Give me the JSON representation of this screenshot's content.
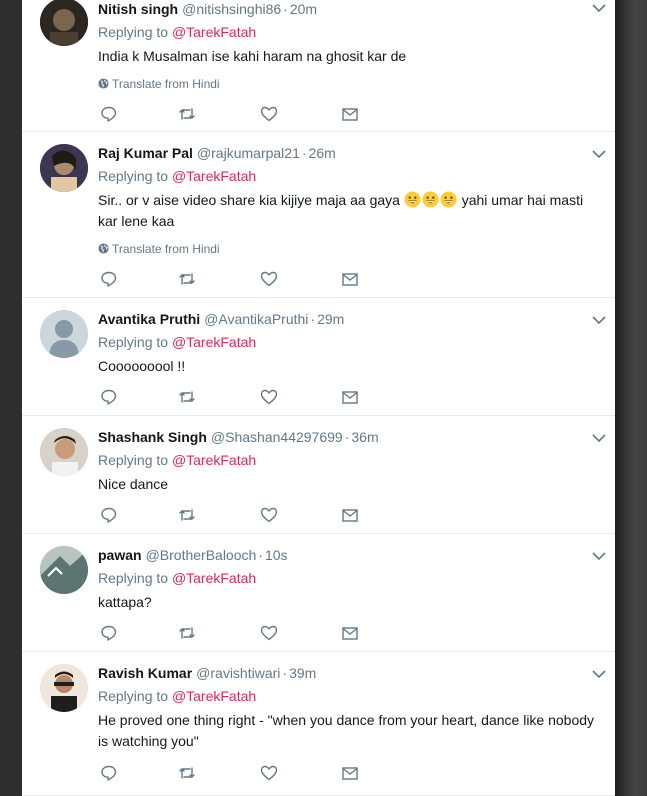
{
  "replies": [
    {
      "name": "Nitish singh",
      "handle": "@nitishsinghi86",
      "time": "20m",
      "replying_prefix": "Replying to",
      "mention": "@TarekFatah",
      "text": "India k Musalman ise kahi haram na ghosit kar de",
      "translate": "Translate from Hindi",
      "avatar_color": "#4a4036"
    },
    {
      "name": "Raj Kumar Pal",
      "handle": "@rajkumarpal21",
      "time": "26m",
      "replying_prefix": "Replying to",
      "mention": "@TarekFatah",
      "text_before_emoji": "Sir.. or v aise video share kia kijiye maja aa gaya",
      "text_after_emoji": "yahi umar hai masti kar lene kaa",
      "emoji_count": 3,
      "emoji_name": "grinning-face-emoji",
      "translate": "Translate from Hindi",
      "avatar_color": "#5b4a6e"
    },
    {
      "name": "Avantika Pruthi",
      "handle": "@AvantikaPruthi",
      "time": "29m",
      "replying_prefix": "Replying to",
      "mention": "@TarekFatah",
      "text": "Cooooooool !!",
      "avatar_color": "#ccd6dd"
    },
    {
      "name": "Shashank Singh",
      "handle": "@Shashan44297699",
      "time": "36m",
      "replying_prefix": "Replying to",
      "mention": "@TarekFatah",
      "text": "Nice dance",
      "avatar_color": "#c9c2b8"
    },
    {
      "name": "pawan",
      "handle": "@BrotherBalooch",
      "time": "10s",
      "replying_prefix": "Replying to",
      "mention": "@TarekFatah",
      "text": "kattapa?",
      "avatar_color": "#6f8a86"
    },
    {
      "name": "Ravish Kumar",
      "handle": "@ravishtiwari",
      "time": "39m",
      "replying_prefix": "Replying to",
      "mention": "@TarekFatah",
      "text": "He proved one thing right - \"when you dance from your heart, dance like nobody is watching you\"",
      "avatar_color": "#e8ddd0"
    }
  ],
  "icons": {
    "caret": "chevron-down-icon",
    "reply": "reply-icon",
    "retweet": "retweet-icon",
    "like": "heart-icon",
    "dm": "envelope-icon",
    "translate": "globe-icon"
  },
  "colors": {
    "mention": "#e0245e",
    "muted": "#657786",
    "text": "#14171a"
  }
}
